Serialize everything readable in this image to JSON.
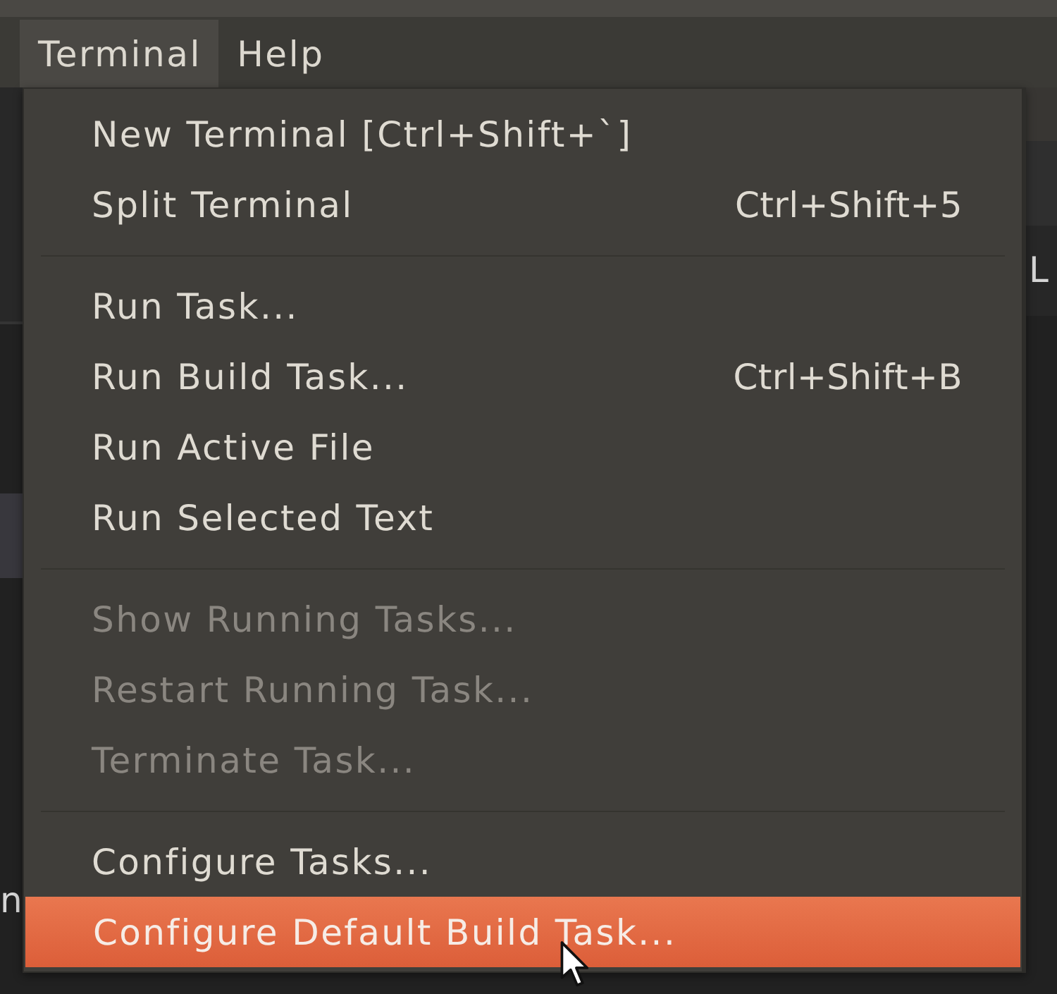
{
  "menu_bar": {
    "items": [
      {
        "label": "Terminal",
        "selected": true
      },
      {
        "label": "Help",
        "selected": false
      }
    ]
  },
  "dropdown": {
    "sections": [
      {
        "items": [
          {
            "label": "New Terminal [Ctrl+Shift+`]",
            "disabled": false,
            "selected": false
          },
          {
            "label": "Split Terminal",
            "shortcut": "Ctrl+Shift+5",
            "disabled": false,
            "selected": false
          }
        ]
      },
      {
        "items": [
          {
            "label": "Run Task...",
            "disabled": false,
            "selected": false
          },
          {
            "label": "Run Build Task...",
            "shortcut": "Ctrl+Shift+B",
            "disabled": false,
            "selected": false
          },
          {
            "label": "Run Active File",
            "disabled": false,
            "selected": false
          },
          {
            "label": "Run Selected Text",
            "disabled": false,
            "selected": false
          }
        ]
      },
      {
        "items": [
          {
            "label": "Show Running Tasks...",
            "disabled": true,
            "selected": false
          },
          {
            "label": "Restart Running Task...",
            "disabled": true,
            "selected": false
          },
          {
            "label": "Terminate Task...",
            "disabled": true,
            "selected": false
          }
        ]
      },
      {
        "items": [
          {
            "label": "Configure Tasks...",
            "disabled": false,
            "selected": false
          },
          {
            "label": "Configure Default Build Task...",
            "disabled": false,
            "selected": true
          }
        ]
      }
    ]
  },
  "editor": {
    "left_edge_text": "n",
    "right_edge_text": "L"
  }
}
